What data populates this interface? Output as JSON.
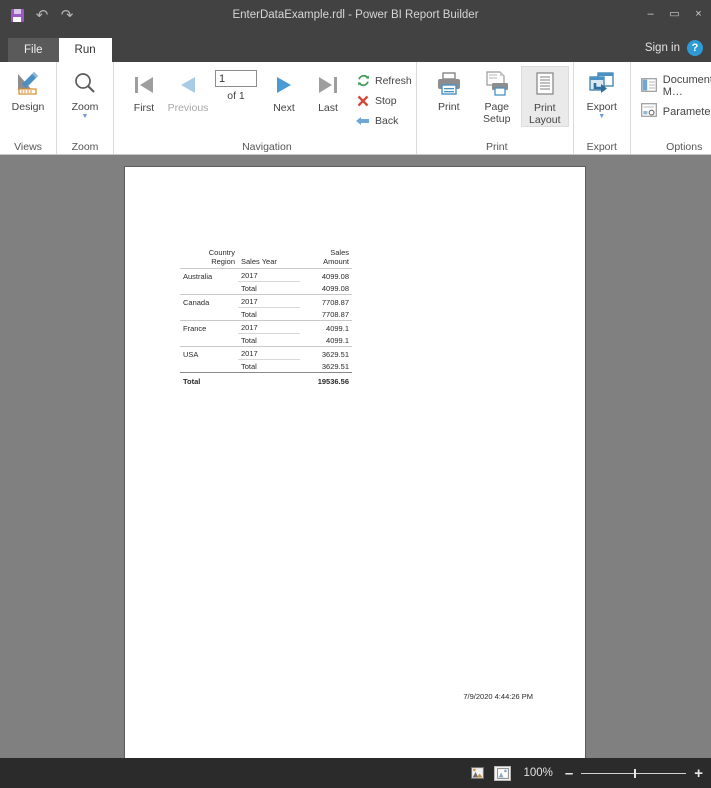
{
  "titlebar": {
    "title": "EnterDataExample.rdl - Power BI Report Builder",
    "quick_access": [
      {
        "name": "save",
        "label": "Save",
        "icon": "save-icon"
      },
      {
        "name": "undo",
        "label": "Undo",
        "icon": "undo-icon",
        "glyph": "↶"
      },
      {
        "name": "redo",
        "label": "Redo",
        "icon": "redo-icon",
        "glyph": "↷"
      }
    ],
    "window_controls": {
      "minimize": "–",
      "maximize": "▭",
      "close": "×"
    }
  },
  "tabs": {
    "items": [
      {
        "label": "File",
        "active": false
      },
      {
        "label": "Run",
        "active": true
      }
    ],
    "sign_in": "Sign in",
    "help": "?"
  },
  "ribbon": {
    "views": {
      "group_label": "Views",
      "design_label": "Design"
    },
    "zoom": {
      "group_label": "Zoom",
      "zoom_label": "Zoom"
    },
    "navigation": {
      "group_label": "Navigation",
      "first_label": "First",
      "previous_label": "Previous",
      "next_label": "Next",
      "last_label": "Last",
      "page_value": "1",
      "of_label": "of  1",
      "refresh_label": "Refresh",
      "stop_label": "Stop",
      "back_label": "Back"
    },
    "print": {
      "group_label": "Print",
      "print_label": "Print",
      "page_setup_label": "Page\nSetup",
      "page_setup_line1": "Page",
      "page_setup_line2": "Setup",
      "print_layout_line1": "Print",
      "print_layout_line2": "Layout"
    },
    "export": {
      "group_label": "Export",
      "export_label": "Export"
    },
    "options": {
      "group_label": "Options",
      "document_map_label": "Document M…",
      "parameters_label": "Parameters"
    }
  },
  "report": {
    "columns": [
      {
        "line1": "Country",
        "line2": "Region",
        "align": "right"
      },
      {
        "line1": "Sales Year",
        "line2": "",
        "align": "left"
      },
      {
        "line1": "Sales",
        "line2": "Amount",
        "align": "right"
      }
    ],
    "rows": [
      {
        "country": "Australia",
        "year": "2017",
        "amount": "4099.08",
        "type": "detail"
      },
      {
        "country": "",
        "year": "Total",
        "amount": "4099.08",
        "type": "subtotal"
      },
      {
        "country": "Canada",
        "year": "2017",
        "amount": "7708.87",
        "type": "detail"
      },
      {
        "country": "",
        "year": "Total",
        "amount": "7708.87",
        "type": "subtotal"
      },
      {
        "country": "France",
        "year": "2017",
        "amount": "4099.1",
        "type": "detail"
      },
      {
        "country": "",
        "year": "Total",
        "amount": "4099.1",
        "type": "subtotal"
      },
      {
        "country": "USA",
        "year": "2017",
        "amount": "3629.51",
        "type": "detail"
      },
      {
        "country": "",
        "year": "Total",
        "amount": "3629.51",
        "type": "subtotal"
      }
    ],
    "grand_total": {
      "label": "Total",
      "amount": "19536.56"
    },
    "timestamp": "7/9/2020 4:44:26 PM"
  },
  "statusbar": {
    "zoom_level": "100%",
    "zoom_out": "–",
    "zoom_in": "+",
    "view_normal": "normal-view-icon",
    "view_page": "page-view-icon"
  },
  "colors": {
    "chrome": "#424242",
    "canvas": "#808080",
    "accent": "#2e9bd6",
    "save": "#9b59c4",
    "refresh": "#3e9b55",
    "stop": "#d04a3b"
  }
}
